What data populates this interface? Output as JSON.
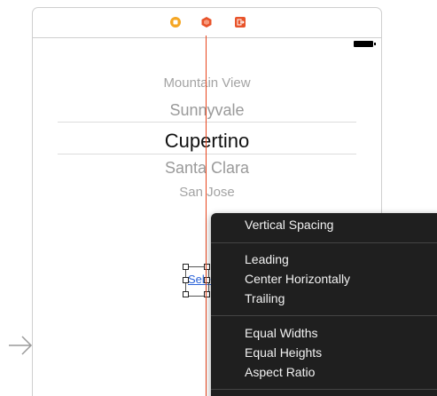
{
  "picker": {
    "rows": [
      "Mountain View",
      "Sunnyvale",
      "Cupertino",
      "Santa Clara",
      "San Jose"
    ],
    "selected_index": 2
  },
  "button": {
    "label": "Select"
  },
  "menu": {
    "groups": [
      [
        "Vertical Spacing"
      ],
      [
        "Leading",
        "Center Horizontally",
        "Trailing"
      ],
      [
        "Equal Widths",
        "Equal Heights",
        "Aspect Ratio"
      ]
    ]
  },
  "colors": {
    "guide": "#e8451d",
    "menu_bg": "#1f1f1f",
    "menu_text": "#f2f2f2",
    "dock_view_controller": "#f5a623",
    "dock_first_responder": "#e8532a",
    "dock_exit": "#e8532a",
    "link": "#2b63d9"
  },
  "icons": [
    "view-controller-icon",
    "first-responder-icon",
    "exit-icon",
    "battery-icon",
    "segue-arrow-icon"
  ]
}
